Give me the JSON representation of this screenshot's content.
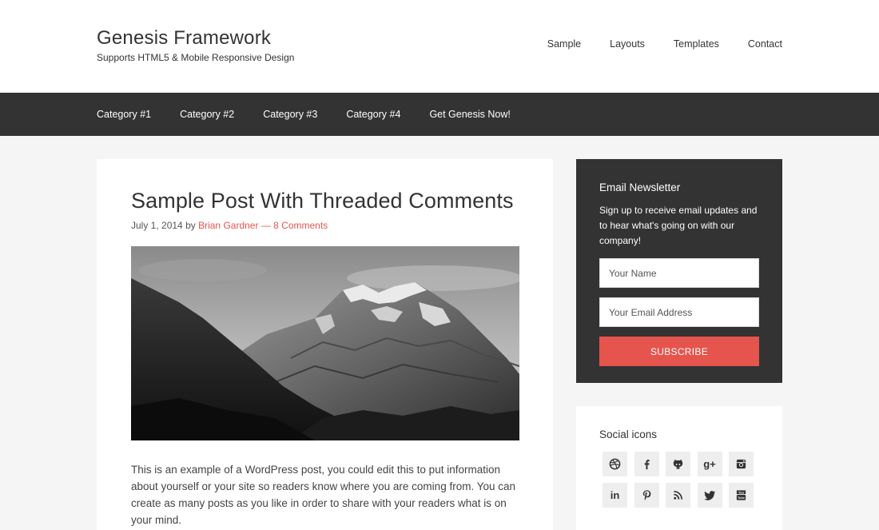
{
  "header": {
    "title": "Genesis Framework",
    "description": "Supports HTML5 & Mobile Responsive Design",
    "nav": [
      "Sample",
      "Layouts",
      "Templates",
      "Contact"
    ]
  },
  "category_nav": [
    "Category #1",
    "Category #2",
    "Category #3",
    "Category #4",
    "Get Genesis Now!"
  ],
  "post": {
    "title": "Sample Post With Threaded Comments",
    "date": "July 1, 2014",
    "by": "by",
    "author": "Brian Gardner",
    "separator": "—",
    "comments": "8 Comments",
    "content": "This is an example of a WordPress post, you could edit this to put information about yourself or your site so readers know where you are coming from. You can create as many posts as you like in order to share with your readers what is on your mind."
  },
  "newsletter": {
    "title": "Email Newsletter",
    "text": "Sign up to receive email updates and to hear what's going on with our company!",
    "name_placeholder": "Your Name",
    "email_placeholder": "Your Email Address",
    "button": "SUBSCRIBE"
  },
  "social": {
    "title": "Social icons",
    "icons": [
      "dribbble-icon",
      "facebook-icon",
      "github-icon",
      "google-plus-icon",
      "instagram-icon",
      "linkedin-icon",
      "pinterest-icon",
      "rss-icon",
      "twitter-icon",
      "youtube-icon"
    ]
  },
  "colors": {
    "accent": "#e5554e",
    "dark": "#333333",
    "background": "#f5f5f5"
  }
}
